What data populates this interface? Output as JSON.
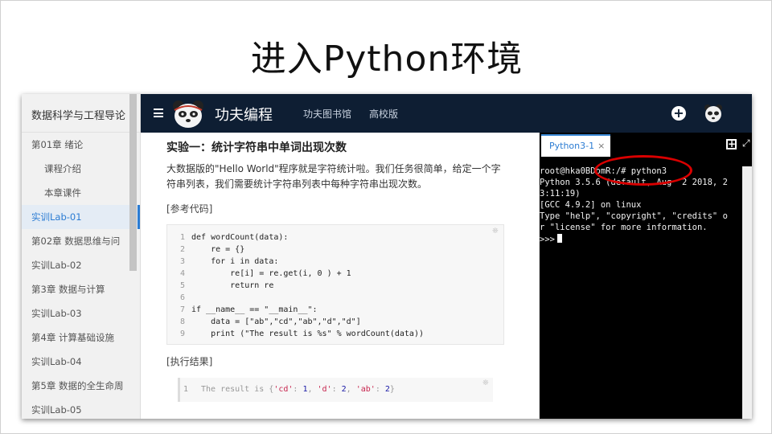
{
  "slide": {
    "title": "进入Python环境"
  },
  "sidebar": {
    "title": "数据科学与工程导论",
    "items": [
      {
        "label": "第01章 绪论",
        "indent": false,
        "active": false
      },
      {
        "label": "课程介绍",
        "indent": true,
        "active": false
      },
      {
        "label": "本章课件",
        "indent": true,
        "active": false
      },
      {
        "label": "实训Lab-01",
        "indent": false,
        "active": true
      },
      {
        "label": "第02章 数据思维与问",
        "indent": false,
        "active": false
      },
      {
        "label": "实训Lab-02",
        "indent": false,
        "active": false
      },
      {
        "label": "第3章 数据与计算",
        "indent": false,
        "active": false
      },
      {
        "label": "实训Lab-03",
        "indent": false,
        "active": false
      },
      {
        "label": "第4章 计算基础设施",
        "indent": false,
        "active": false
      },
      {
        "label": "实训Lab-04",
        "indent": false,
        "active": false
      },
      {
        "label": "第5章 数据的全生命周",
        "indent": false,
        "active": false
      },
      {
        "label": "实训Lab-05",
        "indent": false,
        "active": false
      }
    ]
  },
  "topbar": {
    "brand": "功夫编程",
    "nav": [
      "功夫图书馆",
      "高校版"
    ],
    "plus_label": "+",
    "bg_color": "#0e1e33"
  },
  "content": {
    "lab_title": "实验一：统计字符串中单词出现次数",
    "description": "大数据版的\"Hello World\"程序就是字符统计啦。我们任务很简单，给定一个字符串列表，我们需要统计字符串列表中每种字符串出现次数。",
    "ref_label": "[参考代码]",
    "code": [
      {
        "num": "1",
        "text": "def wordCount(data):"
      },
      {
        "num": "2",
        "text": "    re = {}"
      },
      {
        "num": "3",
        "text": "    for i in data:"
      },
      {
        "num": "4",
        "text": "        re[i] = re.get(i, 0 ) + 1"
      },
      {
        "num": "5",
        "text": "        return re"
      },
      {
        "num": "6",
        "text": ""
      },
      {
        "num": "7",
        "text": "if __name__ == \"__main__\":"
      },
      {
        "num": "8",
        "text": "    data = [\"ab\",\"cd\",\"ab\",\"d\",\"d\"]"
      },
      {
        "num": "9",
        "text": "    print (\"The result is %s\" % wordCount(data))"
      }
    ],
    "result_label": "[执行结果]",
    "result": {
      "num": "1",
      "prefix": "The result is {",
      "k1": "'cd'",
      "v1": "1",
      "k2": "'d'",
      "v2": "2",
      "k3": "'ab'",
      "v3": "2",
      "suffix": "}"
    }
  },
  "terminal": {
    "tab_label": "Python3-1",
    "tab_close": "×",
    "lines": [
      "root@hka0BDomR:/# python3",
      "Python 3.5.6 (default, Aug  2 2018, 2",
      "3:11:19)",
      "[GCC 4.9.2] on linux",
      "Type \"help\", \"copyright\", \"credits\" o",
      "r \"license\" for more information.",
      ">>>"
    ],
    "highlight_color": "#d90000"
  },
  "colors": {
    "accent": "#2b7cd3",
    "code_string": "#c7254e",
    "code_number": "#1a1aa6",
    "code_comment": "#999999"
  }
}
